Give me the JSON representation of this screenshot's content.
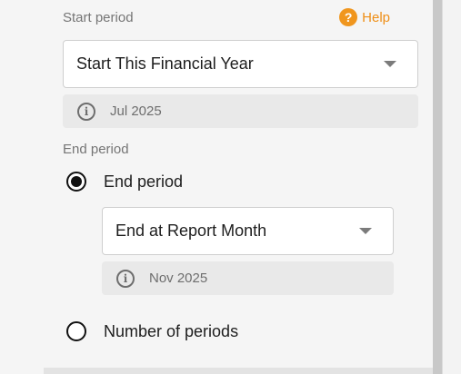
{
  "start": {
    "label": "Start period",
    "help_label": "Help",
    "select_value": "Start This Financial Year",
    "info": "Jul 2025"
  },
  "end": {
    "label": "End period",
    "options": [
      {
        "label": "End period",
        "selected": true
      },
      {
        "label": "Number of periods",
        "selected": false
      }
    ],
    "select_value": "End at Report Month",
    "info": "Nov 2025"
  },
  "icons": {
    "help": "question-circle-icon",
    "info": "info-circle-icon",
    "dropdown": "caret-down-icon"
  },
  "colors": {
    "accent": "#ef8f17",
    "background": "#f5f5f5",
    "info_box": "#e9e9e9"
  }
}
